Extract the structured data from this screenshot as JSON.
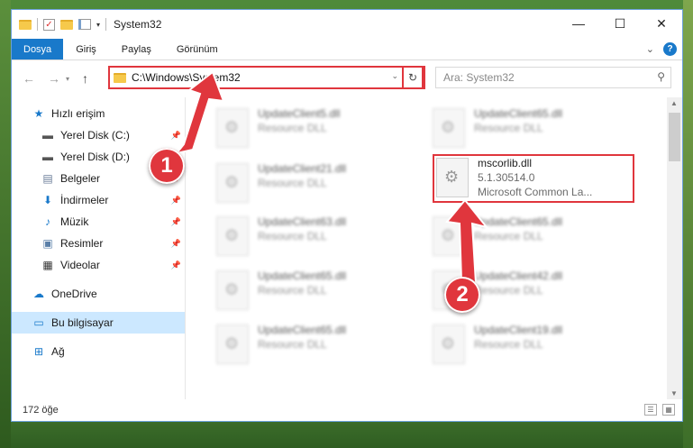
{
  "window": {
    "title": "System32",
    "buttons": {
      "minimize": "—",
      "maximize": "☐",
      "close": "✕"
    }
  },
  "ribbon": {
    "tabs": [
      {
        "label": "Dosya"
      },
      {
        "label": "Giriş"
      },
      {
        "label": "Paylaş"
      },
      {
        "label": "Görünüm"
      }
    ],
    "help": "?"
  },
  "address": {
    "path": "C:\\Windows\\System32",
    "search_placeholder": "Ara: System32"
  },
  "sidebar": {
    "quick_access": "Hızlı erişim",
    "items": [
      {
        "label": "Yerel Disk (C:)"
      },
      {
        "label": "Yerel Disk (D:)"
      },
      {
        "label": "Belgeler"
      },
      {
        "label": "İndirmeler"
      },
      {
        "label": "Müzik"
      },
      {
        "label": "Resimler"
      },
      {
        "label": "Videolar"
      }
    ],
    "onedrive": "OneDrive",
    "this_pc": "Bu bilgisayar",
    "network": "Ağ"
  },
  "files": [
    {
      "name": "UpdateClient5.dll",
      "desc": "Resource DLL"
    },
    {
      "name": "UpdateClient65.dll",
      "desc": "Resource DLL"
    },
    {
      "name": "UpdateClient21.dll",
      "desc": "Resource DLL"
    },
    {
      "name": "mscorlib.dll",
      "version": "5.1.30514.0",
      "desc": "Microsoft Common La..."
    },
    {
      "name": "UpdateClient63.dll",
      "desc": "Resource DLL"
    },
    {
      "name": "UpdateClient65.dll",
      "desc": "Resource DLL"
    },
    {
      "name": "UpdateClient65.dll",
      "desc": "Resource DLL"
    },
    {
      "name": "UpdateClient42.dll",
      "desc": "Resource DLL"
    },
    {
      "name": "UpdateClient65.dll",
      "desc": "Resource DLL"
    },
    {
      "name": "UpdateClient19.dll",
      "desc": "Resource DLL"
    }
  ],
  "status": {
    "count": "172 öğe"
  },
  "callouts": {
    "one": "1",
    "two": "2"
  },
  "colors": {
    "accent": "#1979ca",
    "highlight": "#e0363d"
  }
}
